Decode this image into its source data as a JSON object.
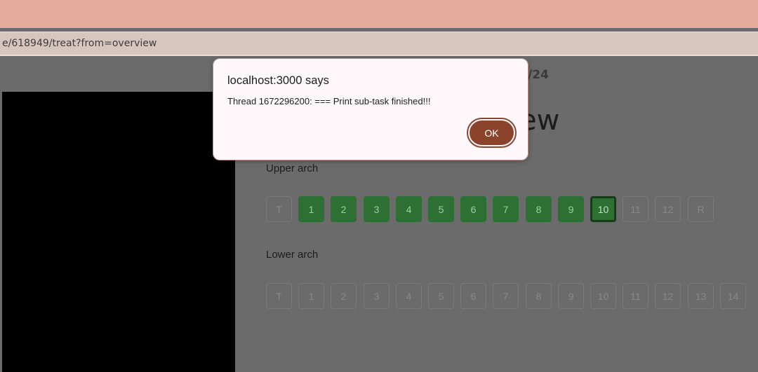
{
  "browser": {
    "address": "e/618949/treat?from=overview"
  },
  "page": {
    "date_fragment": "/24",
    "title_fragment": "ew",
    "upper_arch": {
      "label": "Upper arch",
      "teeth": [
        {
          "label": "T",
          "state": "pending"
        },
        {
          "label": "1",
          "state": "done"
        },
        {
          "label": "2",
          "state": "done"
        },
        {
          "label": "3",
          "state": "done"
        },
        {
          "label": "4",
          "state": "done"
        },
        {
          "label": "5",
          "state": "done"
        },
        {
          "label": "6",
          "state": "done"
        },
        {
          "label": "7",
          "state": "done"
        },
        {
          "label": "8",
          "state": "done"
        },
        {
          "label": "9",
          "state": "done"
        },
        {
          "label": "10",
          "state": "current"
        },
        {
          "label": "11",
          "state": "pending"
        },
        {
          "label": "12",
          "state": "pending"
        },
        {
          "label": "R",
          "state": "pending"
        }
      ]
    },
    "lower_arch": {
      "label": "Lower arch",
      "teeth": [
        {
          "label": "T",
          "state": "pending"
        },
        {
          "label": "1",
          "state": "pending"
        },
        {
          "label": "2",
          "state": "pending"
        },
        {
          "label": "3",
          "state": "pending"
        },
        {
          "label": "4",
          "state": "pending"
        },
        {
          "label": "5",
          "state": "pending"
        },
        {
          "label": "6",
          "state": "pending"
        },
        {
          "label": "7",
          "state": "pending"
        },
        {
          "label": "8",
          "state": "pending"
        },
        {
          "label": "9",
          "state": "pending"
        },
        {
          "label": "10",
          "state": "pending"
        },
        {
          "label": "11",
          "state": "pending"
        },
        {
          "label": "12",
          "state": "pending"
        },
        {
          "label": "13",
          "state": "pending"
        },
        {
          "label": "14",
          "state": "pending"
        }
      ]
    }
  },
  "dialog": {
    "title": "localhost:3000 says",
    "message": "Thread 1672296200: === Print sub-task finished!!!",
    "ok_label": "OK"
  },
  "colors": {
    "done": "#2e6f34",
    "current_border": "#143d18",
    "ok_button": "#8b432c",
    "top_strip": "#e5ac9c"
  }
}
